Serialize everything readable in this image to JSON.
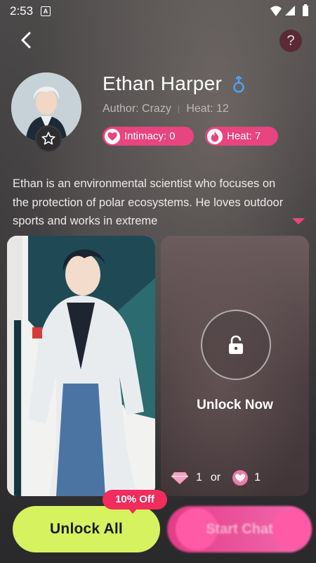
{
  "status_bar": {
    "time": "2:53",
    "app_indicator": "A"
  },
  "header": {
    "back_icon": "chevron-left-icon",
    "help_label": "?"
  },
  "profile": {
    "name": "Ethan Harper",
    "gender_icon": "male-symbol-icon",
    "author": "Author: Crazy",
    "heat_count": "Heat: 12",
    "intimacy_pill": "Intimacy: 0",
    "heat_pill": "Heat: 7",
    "description": "Ethan is an environmental scientist who focuses on the protection of polar ecosystems. He loves outdoor sports and works in extreme"
  },
  "locked_card": {
    "label": "Unlock Now",
    "gem_price": "1",
    "or_label": "or",
    "heart_price": "1"
  },
  "actions": {
    "unlock_all": "Unlock All",
    "discount": "10% Off",
    "start_chat": "Start Chat"
  },
  "colors": {
    "accent_pink": "#e8447f",
    "unlock_all_green": "#d6f25f",
    "discount_red": "#f22c5c"
  }
}
